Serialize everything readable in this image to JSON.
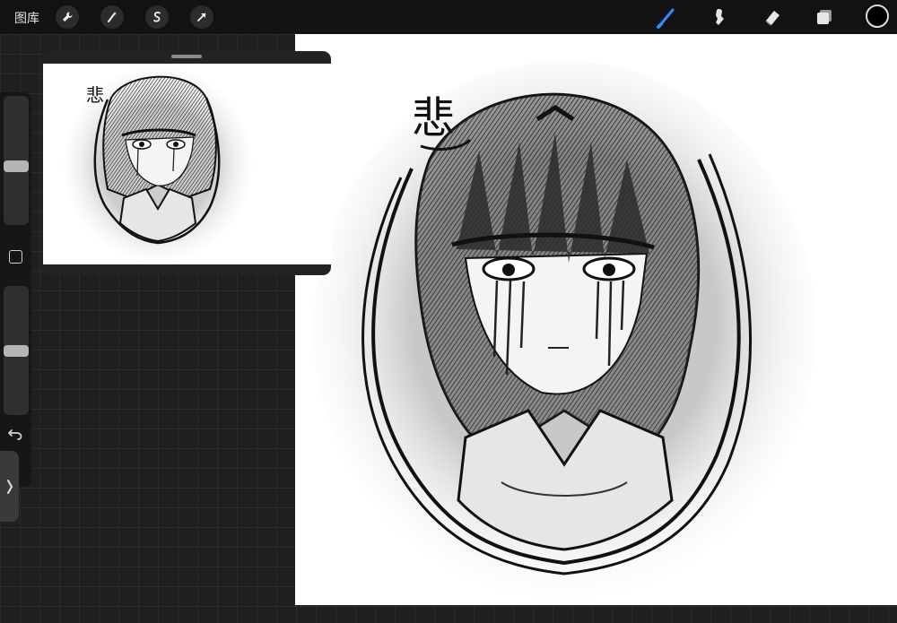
{
  "topbar": {
    "gallery_label": "图库",
    "left_tools": [
      "wrench-icon",
      "magic-wand-icon",
      "selection-icon",
      "transform-arrow-icon"
    ],
    "right_tools": [
      "brush-icon",
      "smudge-icon",
      "eraser-icon",
      "layers-icon"
    ],
    "active_tool": "brush",
    "accent_color": "#2f8bff",
    "current_color": "#000000"
  },
  "sidebar": {
    "brush_size_level": 0.55,
    "opacity_level": 0.5,
    "modify_button": "modify-square-icon",
    "undo_icon": "undo-icon",
    "expand_icon": "chevron-right-icon"
  },
  "canvas": {
    "artwork_character": "悲",
    "background": "#ffffff"
  },
  "reference": {
    "artwork_character": "悲"
  }
}
